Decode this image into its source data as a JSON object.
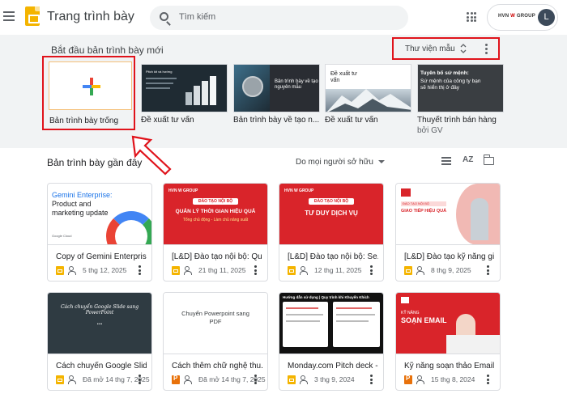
{
  "header": {
    "app_title": "Trang trình bày",
    "search_placeholder": "Tìm kiếm",
    "account_brand": "HVN",
    "account_brand_accent": "W",
    "account_brand_suffix": "GROUP",
    "avatar_initial": "L"
  },
  "templates": {
    "title": "Bắt đầu bản trình bày mới",
    "gallery_label": "Thư viện mẫu",
    "items": [
      {
        "label": "Bản trình bày trống",
        "sub": ""
      },
      {
        "label": "Đề xuất tư vấn",
        "sub": "",
        "thumb_title": "Pitch kit và hướng"
      },
      {
        "label": "Bản trình bày về tạo n...",
        "sub": "",
        "thumb_title": "Bản trình bày về tạo nguyên mẫu"
      },
      {
        "label": "Đề xuất tư vấn",
        "sub": "",
        "thumb_title": "Đề xuất tư vấn"
      },
      {
        "label": "Thuyết trình bán hàng",
        "sub": "bởi GV",
        "thumb_title": "Tuyên bố sứ mệnh:",
        "thumb_text": "Sứ mệnh của công ty bạn sẽ hiển thị ở đây"
      }
    ]
  },
  "recent": {
    "title": "Bản trình bày gần đây",
    "owner_filter": "Do mọi người sở hữu",
    "sort_label": "AZ",
    "cards": [
      {
        "name": "Copy of Gemini Enterpris...",
        "meta": "5 thg 12, 2025",
        "thumb_title": "Gemini Enterprise:",
        "thumb_sub": "Product and marketing update",
        "thumb_footer": "Google Cloud"
      },
      {
        "name": "[L&D] Đào tạo nội bộ: Qu...",
        "meta": "21 thg 11, 2025",
        "thumb_pill": "ĐÀO TẠO NỘI BỘ",
        "thumb_title": "QUẢN LÝ THỜI GIAN HIỆU QUẢ",
        "thumb_sub": "Tổng chủ động - Làm chủ năng suất"
      },
      {
        "name": "[L&D] Đào tạo nội bộ: Se...",
        "meta": "12 thg 11, 2025",
        "thumb_pill": "ĐÀO TẠO NỘI BỘ",
        "thumb_title": "TƯ DUY DỊCH VỤ"
      },
      {
        "name": "[L&D] Đào tạo kỹ năng gi...",
        "meta": "8 thg 9, 2025",
        "thumb_pill": "ĐÀO TẠO NỘI BỘ",
        "thumb_title": "GIAO TIẾP HIỆU QUẢ"
      },
      {
        "name": "Cách chuyển Google Slid...",
        "meta": "Đã mở 14 thg 7, 2025",
        "thumb_title": "Cách chuyển Google Slide sang PowerPoint",
        "thumb_sub": "..."
      },
      {
        "name": "Cách thêm chữ nghệ thu...",
        "meta": "Đã mở 14 thg 7, 2025",
        "thumb_title": "Chuyển Powerpoint sang PDF"
      },
      {
        "name": "Monday.com Pitch deck -...",
        "meta": "3 thg 9, 2024",
        "thumb_title": "Hướng dẫn sử dụng | Quy trình khi Khuyến Khích"
      },
      {
        "name": "Kỹ năng soạn thảo Email ...",
        "meta": "15 thg 8, 2024",
        "thumb_pill": "KỸ NĂNG",
        "thumb_title": "SOẠN EMAIL"
      }
    ]
  },
  "colors": {
    "highlight": "#e0131b",
    "slides_yellow": "#f4b400",
    "ppt_orange": "#e8710a",
    "brand_red": "#d9242a"
  }
}
